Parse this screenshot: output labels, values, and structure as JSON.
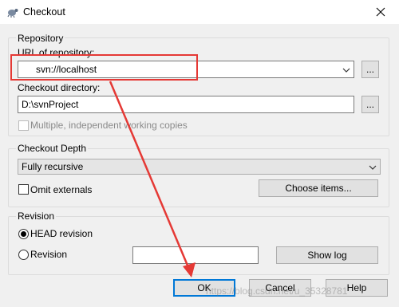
{
  "window": {
    "title": "Checkout"
  },
  "repository": {
    "group_title": "Repository",
    "url_label": "URL of repository:",
    "url_value": "svn://localhost",
    "dir_label": "Checkout directory:",
    "dir_value": "D:\\svnProject",
    "browse_label": "...",
    "multiple_label": "Multiple, independent working copies"
  },
  "depth": {
    "group_title": "Checkout Depth",
    "selected": "Fully recursive",
    "omit_label": "Omit externals",
    "choose_items_label": "Choose items..."
  },
  "revision": {
    "group_title": "Revision",
    "head_label": "HEAD revision",
    "revision_label": "Revision",
    "revision_value": "",
    "show_log_label": "Show log"
  },
  "buttons": {
    "ok": "OK",
    "cancel": "Cancel",
    "help": "Help"
  },
  "watermark": "https://blog.csdn.net/u_35328781",
  "colors": {
    "annotation": "#e53935",
    "default_button_border": "#0078d7"
  },
  "icons": {
    "title": "tortoise-svn-icon",
    "close": "close-icon",
    "dropdown": "chevron-down-icon"
  }
}
